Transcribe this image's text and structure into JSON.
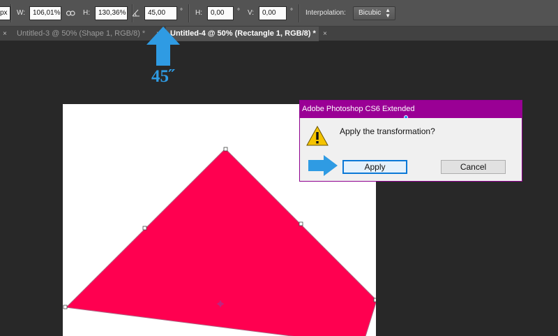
{
  "toolbar": {
    "px_unit": "px",
    "w_label": "W:",
    "w_value": "106,01%",
    "h_label": "H:",
    "h_value": "130,36%",
    "angle_value": "45,00",
    "angle_unit": "°",
    "hskew_label": "H:",
    "hskew_value": "0,00",
    "hskew_unit": "°",
    "vskew_label": "V:",
    "vskew_value": "0,00",
    "vskew_unit": "°",
    "interpolation_label": "Interpolation:",
    "interpolation_value": "Bicubic"
  },
  "tabs": [
    {
      "label": "Untitled-3 @ 50% (Shape 1, RGB/8) *",
      "active": false
    },
    {
      "label": "Untitled-4 @ 50% (Rectangle 1, RGB/8) *",
      "active": true
    }
  ],
  "annotation": {
    "text": "45˝",
    "color": "#2f9be3"
  },
  "canvas": {
    "shape_color": "#ff0050"
  },
  "dialog": {
    "title": "Adobe Photoshop CS6 Extended",
    "message": "Apply the transformation?",
    "apply_label": "Apply",
    "cancel_label": "Cancel",
    "title_color": "#9a0095"
  }
}
